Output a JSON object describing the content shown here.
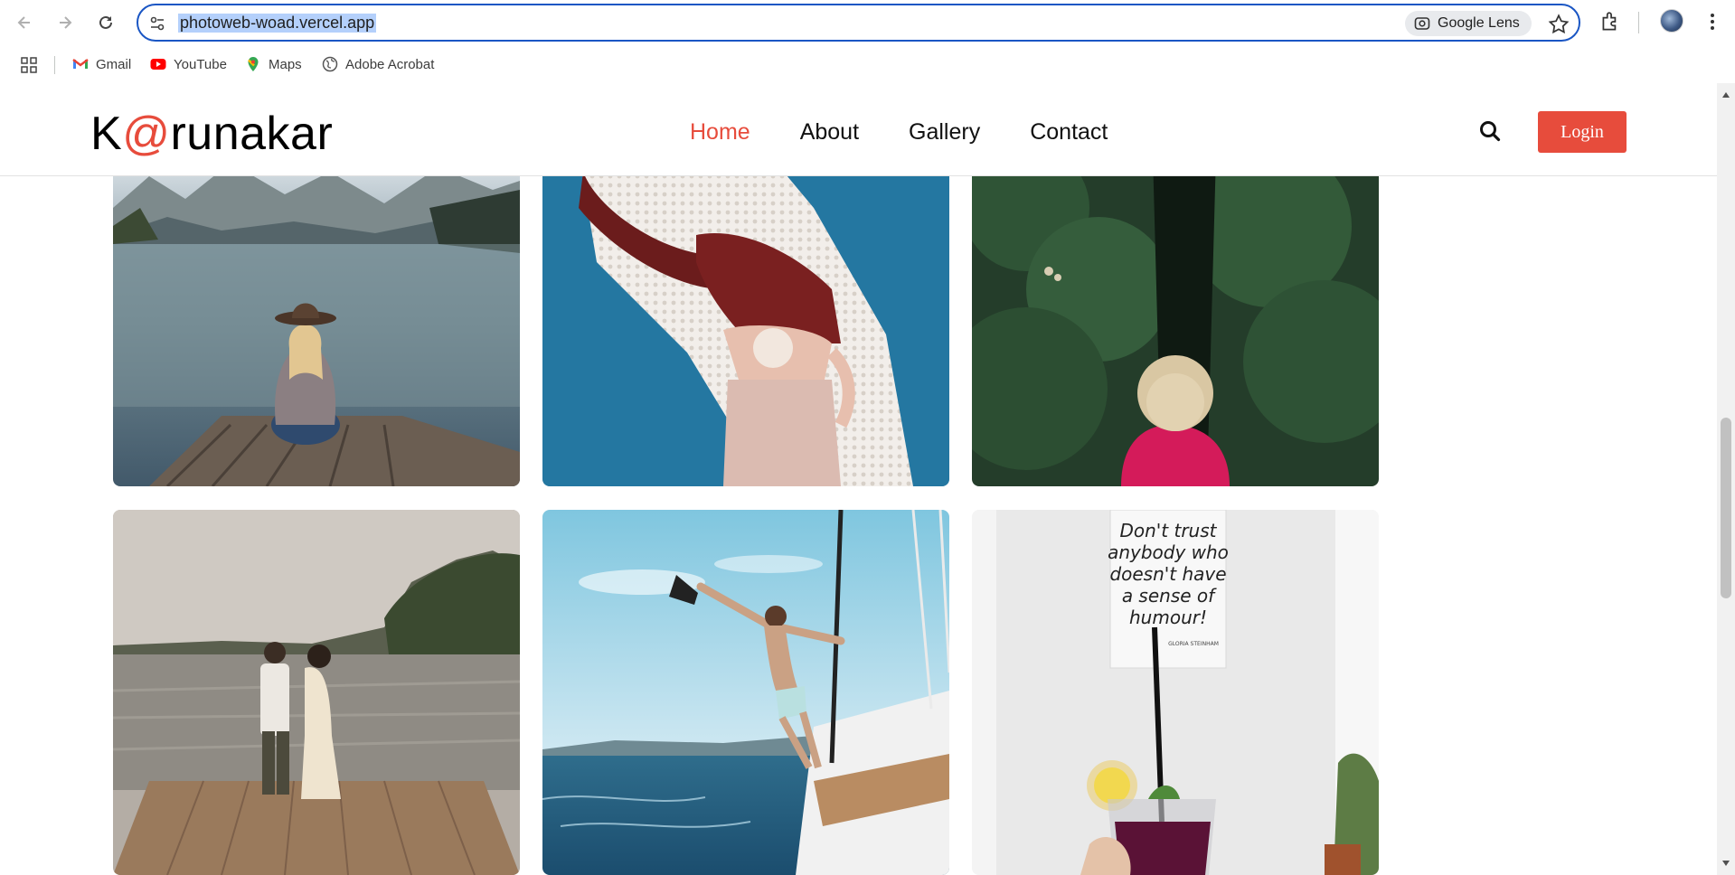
{
  "browser": {
    "url": "photoweb-woad.vercel.app",
    "lens_label": "Google Lens",
    "bookmarks": [
      {
        "label": "Gmail",
        "icon": "gmail-icon"
      },
      {
        "label": "YouTube",
        "icon": "youtube-icon"
      },
      {
        "label": "Maps",
        "icon": "maps-icon"
      },
      {
        "label": "Adobe Acrobat",
        "icon": "globe-icon"
      }
    ]
  },
  "site": {
    "logo_prefix": "K",
    "logo_at": "@",
    "logo_suffix": "runakar",
    "nav": [
      {
        "label": "Home",
        "active": true
      },
      {
        "label": "About",
        "active": false
      },
      {
        "label": "Gallery",
        "active": false
      },
      {
        "label": "Contact",
        "active": false
      }
    ],
    "login_label": "Login",
    "accent_color": "#e74c3c"
  },
  "gallery": {
    "photos": [
      {
        "name": "woman-hat-lake-dock"
      },
      {
        "name": "lace-veil-blue-sky"
      },
      {
        "name": "child-green-hedge"
      },
      {
        "name": "couple-walking-pier"
      },
      {
        "name": "man-on-sailboat"
      },
      {
        "name": "poster-and-smoothie"
      }
    ],
    "poster_text": [
      "Don't trust",
      "anybody who",
      "doesn't have",
      "a sense of",
      "humour!"
    ],
    "poster_author": "GLORIA STEINHAM"
  }
}
